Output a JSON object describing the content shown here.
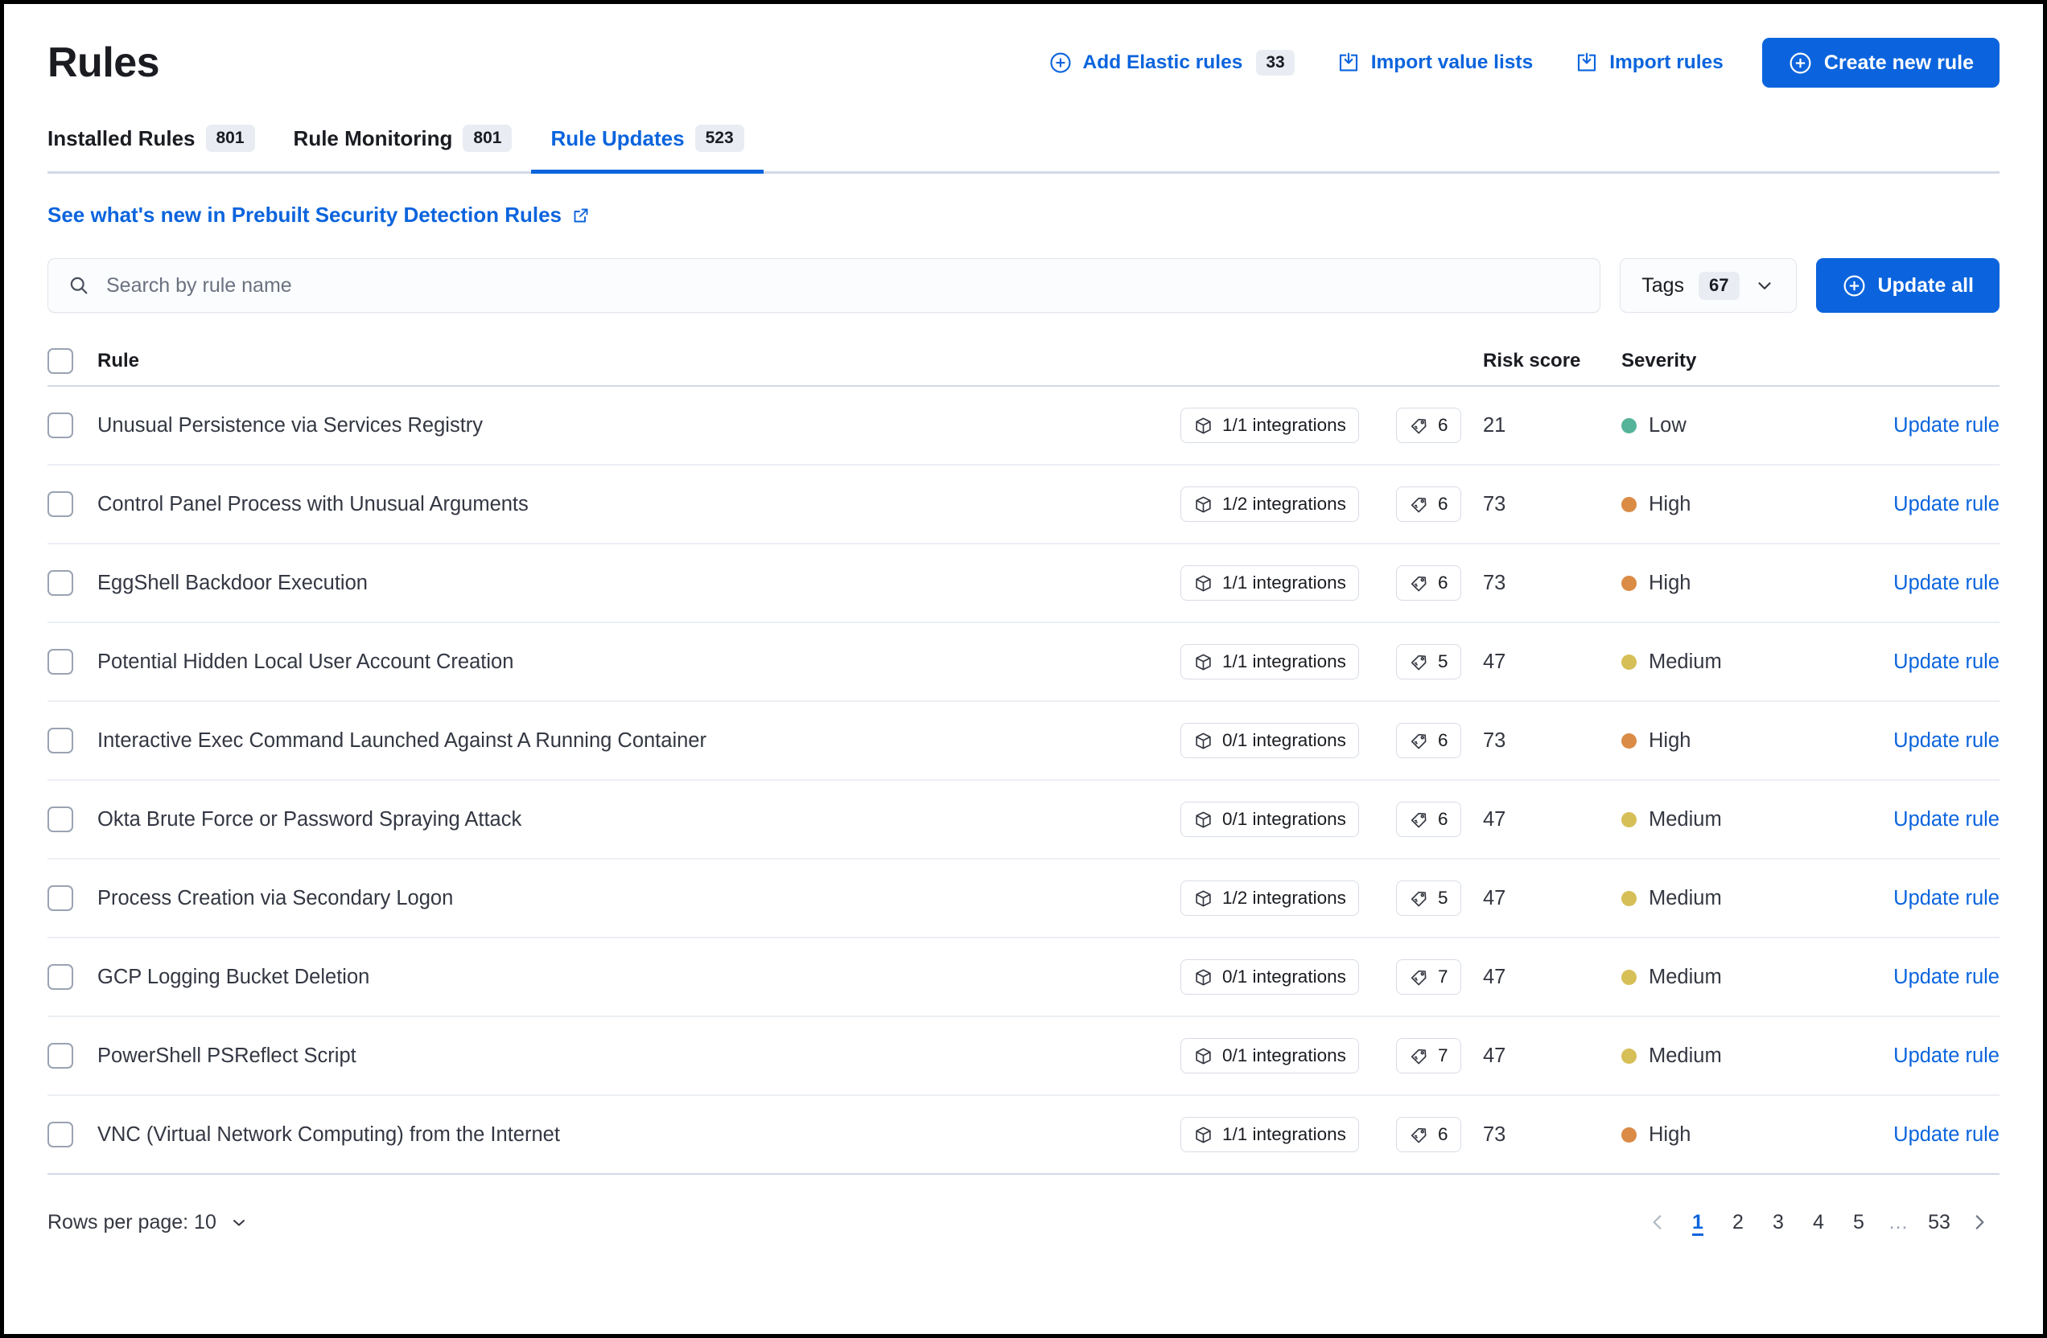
{
  "header": {
    "title": "Rules",
    "actions": [
      {
        "label": "Add Elastic rules",
        "count": "33",
        "icon": "plus-circle-icon"
      },
      {
        "label": "Import value lists",
        "icon": "import-icon"
      },
      {
        "label": "Import rules",
        "icon": "import-icon"
      }
    ],
    "primary_button": {
      "label": "Create new rule",
      "icon": "plus-circle-icon"
    }
  },
  "tabs": [
    {
      "label": "Installed Rules",
      "count": "801",
      "active": false
    },
    {
      "label": "Rule Monitoring",
      "count": "801",
      "active": false
    },
    {
      "label": "Rule Updates",
      "count": "523",
      "active": true
    }
  ],
  "whats_new_link": {
    "label": "See what's new in Prebuilt Security Detection Rules",
    "icon": "external-link-icon"
  },
  "search": {
    "placeholder": "Search by rule name",
    "value": "",
    "icon": "search-icon"
  },
  "tags_filter": {
    "label": "Tags",
    "count": "67",
    "icon": "chevron-down-icon"
  },
  "update_all_button": {
    "label": "Update all",
    "icon": "plus-circle-icon"
  },
  "table": {
    "columns": {
      "rule": "Rule",
      "risk_score": "Risk score",
      "severity": "Severity"
    },
    "action_label": "Update rule",
    "rows": [
      {
        "name": "Unusual Persistence via Services Registry",
        "integrations": "1/1 integrations",
        "tags": "6",
        "risk_score": "21",
        "severity": "Low",
        "severity_color": "#54b399",
        "action": "Update rule"
      },
      {
        "name": "Control Panel Process with Unusual Arguments",
        "integrations": "1/2 integrations",
        "tags": "6",
        "risk_score": "73",
        "severity": "High",
        "severity_color": "#da8b45",
        "action": "Update rule"
      },
      {
        "name": "EggShell Backdoor Execution",
        "integrations": "1/1 integrations",
        "tags": "6",
        "risk_score": "73",
        "severity": "High",
        "severity_color": "#da8b45",
        "action": "Update rule"
      },
      {
        "name": "Potential Hidden Local User Account Creation",
        "integrations": "1/1 integrations",
        "tags": "5",
        "risk_score": "47",
        "severity": "Medium",
        "severity_color": "#d6bf57",
        "action": "Update rule"
      },
      {
        "name": "Interactive Exec Command Launched Against A Running Container",
        "integrations": "0/1 integrations",
        "tags": "6",
        "risk_score": "73",
        "severity": "High",
        "severity_color": "#da8b45",
        "action": "Update rule"
      },
      {
        "name": "Okta Brute Force or Password Spraying Attack",
        "integrations": "0/1 integrations",
        "tags": "6",
        "risk_score": "47",
        "severity": "Medium",
        "severity_color": "#d6bf57",
        "action": "Update rule"
      },
      {
        "name": "Process Creation via Secondary Logon",
        "integrations": "1/2 integrations",
        "tags": "5",
        "risk_score": "47",
        "severity": "Medium",
        "severity_color": "#d6bf57",
        "action": "Update rule"
      },
      {
        "name": "GCP Logging Bucket Deletion",
        "integrations": "0/1 integrations",
        "tags": "7",
        "risk_score": "47",
        "severity": "Medium",
        "severity_color": "#d6bf57",
        "action": "Update rule"
      },
      {
        "name": "PowerShell PSReflect Script",
        "integrations": "0/1 integrations",
        "tags": "7",
        "risk_score": "47",
        "severity": "Medium",
        "severity_color": "#d6bf57",
        "action": "Update rule"
      },
      {
        "name": "VNC (Virtual Network Computing) from the Internet",
        "integrations": "1/1 integrations",
        "tags": "6",
        "risk_score": "73",
        "severity": "High",
        "severity_color": "#da8b45",
        "action": "Update rule"
      }
    ]
  },
  "footer": {
    "rows_per_page": "Rows per page: 10",
    "pagination": {
      "prev_icon": "chevron-left-icon",
      "next_icon": "chevron-right-icon",
      "pages": [
        "1",
        "2",
        "3",
        "4",
        "5",
        "…",
        "53"
      ],
      "current": "1"
    }
  },
  "colors": {
    "accent": "#0b64dd",
    "low": "#54b399",
    "medium": "#d6bf57",
    "high": "#da8b45",
    "text": "#343741",
    "border": "#d3dae6"
  }
}
